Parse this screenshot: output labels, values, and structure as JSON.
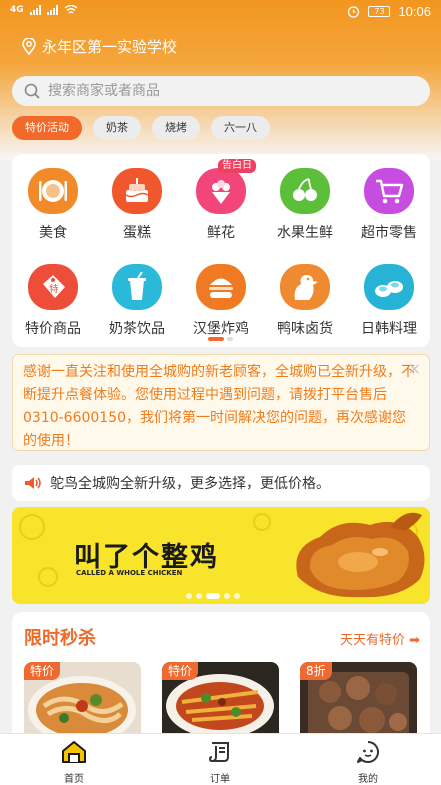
{
  "status_bar": {
    "time": "10:06",
    "battery": "73",
    "network": "4G"
  },
  "location": {
    "name": "永年区第一实验学校"
  },
  "search": {
    "placeholder": "搜索商家或者商品"
  },
  "chips": [
    "特价活动",
    "奶茶",
    "烧烤",
    "六一八"
  ],
  "categories": [
    {
      "label": "美食",
      "icon": "food-icon",
      "color": "#f38a2a"
    },
    {
      "label": "蛋糕",
      "icon": "cake-icon",
      "color": "#f1572d"
    },
    {
      "label": "鲜花",
      "icon": "flower-icon",
      "color": "#f2467a",
      "badge": "告白日"
    },
    {
      "label": "水果生鲜",
      "icon": "fruit-icon",
      "color": "#5cbf3a"
    },
    {
      "label": "超市零售",
      "icon": "cart-icon",
      "color": "#c74ce0"
    },
    {
      "label": "特价商品",
      "icon": "price-tag-icon",
      "color": "#ee4d3a"
    },
    {
      "label": "奶茶饮品",
      "icon": "drink-icon",
      "color": "#2ab9d9"
    },
    {
      "label": "汉堡炸鸡",
      "icon": "burger-icon",
      "color": "#f07a24"
    },
    {
      "label": "鸭味卤货",
      "icon": "duck-icon",
      "color": "#f08a30"
    },
    {
      "label": "日韩料理",
      "icon": "sushi-icon",
      "color": "#26b3d6"
    }
  ],
  "notice": {
    "text": "感谢一直关注和使用全城购的新老顾客，全城购已全新升级，不断提升点餐体验。您使用过程中遇到问题，请拨打平台售后 0310-6600150，我们将第一时间解决您的问题，再次感谢您的使用！"
  },
  "announcement": {
    "text": "鸵鸟全城购全新升级，更多选择，更低价格。"
  },
  "banner": {
    "title": "叫了个整鸡",
    "subtitle": "CALLED A WHOLE CHICKEN"
  },
  "flash_sale": {
    "title": "限时秒杀",
    "more": "天天有特价",
    "products": [
      {
        "tag": "特价"
      },
      {
        "tag": "特价"
      },
      {
        "tag": "8折"
      }
    ]
  },
  "tabs": [
    {
      "label": "首页",
      "icon": "home-icon"
    },
    {
      "label": "订单",
      "icon": "order-icon"
    },
    {
      "label": "我的",
      "icon": "profile-icon"
    }
  ]
}
